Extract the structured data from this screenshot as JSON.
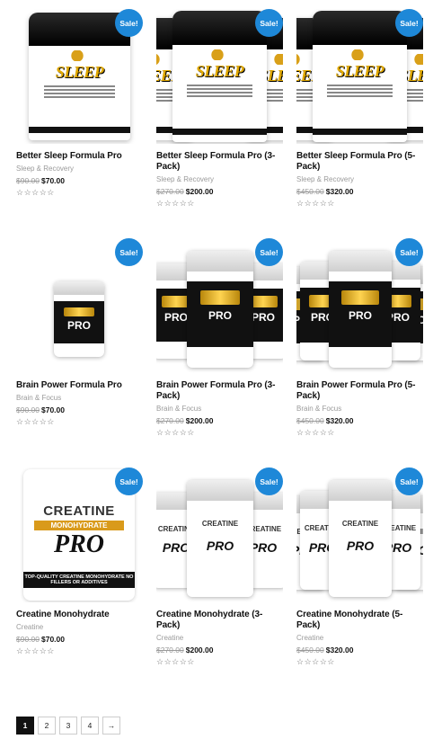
{
  "sale_label": "Sale!",
  "products": [
    {
      "title": "Better Sleep Formula Pro",
      "category": "Sleep & Recovery",
      "old_price": "$90.00",
      "new_price": "$70.00",
      "rating": "☆☆☆☆☆",
      "art": "jar",
      "count": 1
    },
    {
      "title": "Better Sleep Formula Pro (3-Pack)",
      "category": "Sleep & Recovery",
      "old_price": "$270.00",
      "new_price": "$200.00",
      "rating": "☆☆☆☆☆",
      "art": "jar",
      "count": 3
    },
    {
      "title": "Better Sleep Formula Pro (5-Pack)",
      "category": "Sleep & Recovery",
      "old_price": "$450.00",
      "new_price": "$320.00",
      "rating": "☆☆☆☆☆",
      "art": "jar",
      "count": 5
    },
    {
      "title": "Brain Power Formula Pro",
      "category": "Brain & Focus",
      "old_price": "$90.00",
      "new_price": "$70.00",
      "rating": "☆☆☆☆☆",
      "art": "bottle",
      "count": 1
    },
    {
      "title": "Brain Power Formula Pro (3-Pack)",
      "category": "Brain & Focus",
      "old_price": "$270.00",
      "new_price": "$200.00",
      "rating": "☆☆☆☆☆",
      "art": "bottle",
      "count": 3
    },
    {
      "title": "Brain Power Formula Pro (5-Pack)",
      "category": "Brain & Focus",
      "old_price": "$450.00",
      "new_price": "$320.00",
      "rating": "☆☆☆☆☆",
      "art": "bottle",
      "count": 5
    },
    {
      "title": "Creatine Monohydrate",
      "category": "Creatine",
      "old_price": "$90.00",
      "new_price": "$70.00",
      "rating": "☆☆☆☆☆",
      "art": "pouch",
      "count": 1
    },
    {
      "title": "Creatine Monohydrate (3-Pack)",
      "category": "Creatine",
      "old_price": "$270.00",
      "new_price": "$200.00",
      "rating": "☆☆☆☆☆",
      "art": "creatine-bottle",
      "count": 3
    },
    {
      "title": "Creatine Monohydrate (5-Pack)",
      "category": "Creatine",
      "old_price": "$450.00",
      "new_price": "$320.00",
      "rating": "☆☆☆☆☆",
      "art": "creatine-bottle",
      "count": 5
    }
  ],
  "art_text": {
    "sleep_top": "BETTER",
    "sleep_big": "SLEEP",
    "sleep_sub": "FORMULA PRO",
    "brain_pro": "PRO",
    "creatine_word": "CREATINE",
    "creatine_mono": "MONOHYDRATE",
    "creatine_pro": "PRO",
    "creatine_foot": "TOP-QUALITY CREATINE MONOHYDRATE NO FILLERS OR ADDITIVES"
  },
  "pagination": {
    "pages": [
      "1",
      "2",
      "3",
      "4"
    ],
    "current": "1",
    "next": "→"
  },
  "colors": {
    "sale_badge": "#1e88d8",
    "gold": "#e0a800"
  }
}
